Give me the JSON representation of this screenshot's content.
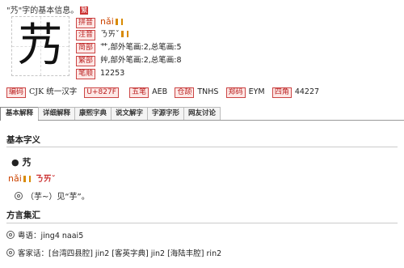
{
  "top_note": "\"艿\"字的基本信息。",
  "fan_button": "繁",
  "character": "艿",
  "rows": {
    "pinyin": {
      "label": "拼音",
      "value": "nǎi"
    },
    "zhuyin": {
      "label": "注音",
      "value": "ㄋㄞˇ"
    },
    "simplified": {
      "label": "简部",
      "value": "艹,部外笔画:2,总笔画:5"
    },
    "traditional": {
      "label": "繁部",
      "value": "艸,部外笔画:2,总笔画:8"
    },
    "stroke_order": {
      "label": "笔顺",
      "value": "12253"
    }
  },
  "codes": {
    "bianma": {
      "label": "编码",
      "value": "CJK 统一汉字"
    },
    "unicode": {
      "label": "U+827F"
    },
    "wubi": {
      "label": "五笔",
      "value": "AEB"
    },
    "cangjie": {
      "label": "仓颉",
      "value": "TNHS"
    },
    "zhengma": {
      "label": "郑码",
      "value": "EYM"
    },
    "sijiao": {
      "label": "四角",
      "value": "44227"
    }
  },
  "tabs": [
    "基本解释",
    "详细解释",
    "康熙字典",
    "说文解字",
    "字源字形",
    "网友讨论"
  ],
  "basic": {
    "heading": "基本字义",
    "char": "艿",
    "pinyin": "nǎi",
    "zhuyin": "ㄋㄞˇ",
    "gloss": "（芋~）见“芋”。"
  },
  "dialect": {
    "heading": "方言集汇",
    "items": [
      "粤语：jing4 naai5",
      "客家话：[台湾四县腔] jin2 [客英字典] jin2 [海陆丰腔] rin2"
    ]
  }
}
